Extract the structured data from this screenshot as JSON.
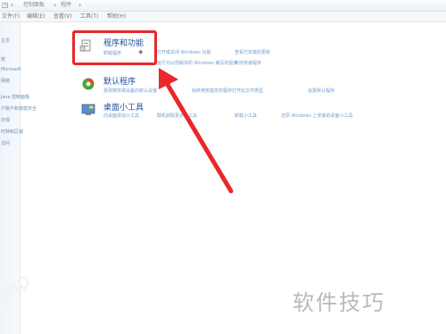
{
  "address_bar": {
    "crumbs": [
      "控制面板",
      "程序"
    ]
  },
  "menu": {
    "items": [
      "文件(F)",
      "编辑(E)",
      "查看(V)",
      "工具(T)",
      "帮助(H)"
    ]
  },
  "left_nav": {
    "items": [
      "主页",
      "统",
      "Microsoft",
      "网络",
      "",
      "Java 控制面板",
      "户账户和家庭安全",
      "外观",
      "时钟和区域",
      "访问"
    ]
  },
  "categories": [
    {
      "title": "程序和功能",
      "icon": "programs-features-icon",
      "links": [
        "卸载程序",
        "打开或关闭 Windows 功能",
        "查看已安装的更新",
        "运行为以前版本的 Windows 编写的程序",
        "如何安装程序"
      ]
    },
    {
      "title": "默认程序",
      "icon": "default-programs-icon",
      "links": [
        "更改媒体或设备的默认设置",
        "始终使用指定的程序打开此文件类型",
        "设置默认程序"
      ]
    },
    {
      "title": "桌面小工具",
      "icon": "desktop-gadgets-icon",
      "links": [
        "向桌面添加小工具",
        "联机获取更多小工具",
        "卸载小工具",
        "还原 Windows 上安装的桌面小工具"
      ]
    }
  ],
  "watermark": {
    "logo": "软件技巧",
    "diagonal": "php"
  },
  "colors": {
    "highlight": "#e8282a",
    "link": "#6f9fd0",
    "title": "#1f4e98"
  }
}
